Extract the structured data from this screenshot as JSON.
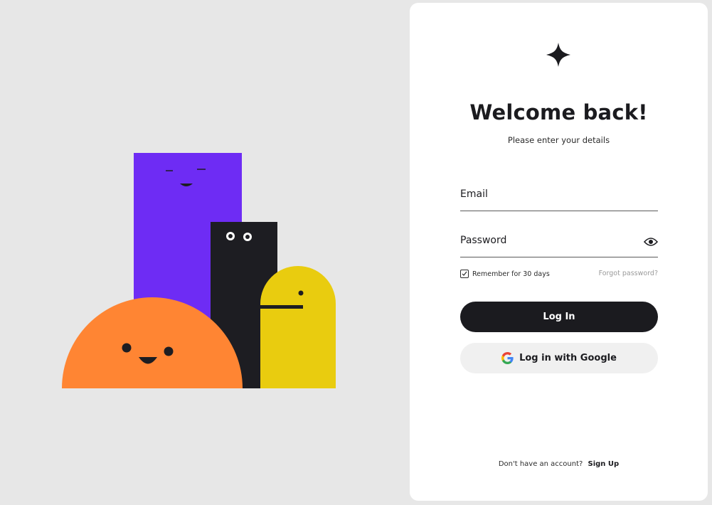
{
  "login": {
    "title": "Welcome back!",
    "subtitle": "Please enter your details",
    "email_placeholder": "Email",
    "email_value": "",
    "password_placeholder": "Password",
    "password_value": "",
    "remember_label": "Remember for 30 days",
    "remember_checked": true,
    "forgot_label": "Forgot password?",
    "login_button": "Log In",
    "google_button": "Log in with Google",
    "signup_prompt": "Don't have an account?",
    "signup_link": "Sign Up"
  },
  "icons": {
    "logo": "sparkle-logo",
    "password_toggle": "eye-icon",
    "google": "google-g-icon",
    "checkbox": "checkmark-icon"
  },
  "colors": {
    "background": "#e7e7e7",
    "card": "#ffffff",
    "primary": "#1b1b1f",
    "secondary_button": "#f0f0f0",
    "purple": "#6e2cf4",
    "orange": "#ff8533",
    "yellow": "#e9cc0f",
    "black": "#1d1d22"
  }
}
